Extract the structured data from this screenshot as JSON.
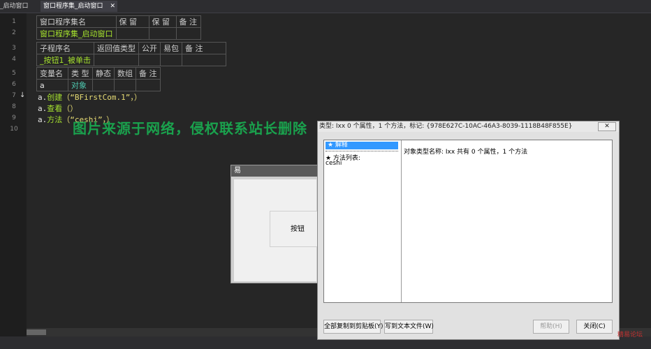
{
  "tabs": [
    {
      "label": "_启动窗口"
    },
    {
      "label": "窗口程序集_启动窗口",
      "close": "✕"
    }
  ],
  "line_numbers": [
    "1",
    "2",
    "3",
    "4",
    "5",
    "6",
    "7",
    "8",
    "9",
    "10"
  ],
  "assembly_table": {
    "headers": [
      "窗口程序集名",
      "保 留",
      "保 留",
      "备 注"
    ],
    "row": [
      "窗口程序集_启动窗口",
      "",
      "",
      ""
    ]
  },
  "sub_table": {
    "headers": [
      "子程序名",
      "返回值类型",
      "公开",
      "易包",
      "备 注"
    ],
    "row": [
      "_按钮1_被单击",
      "",
      "",
      "",
      ""
    ]
  },
  "var_table": {
    "headers": [
      "变量名",
      "类 型",
      "静态",
      "数组",
      "备 注"
    ],
    "row": [
      "a",
      "对象",
      "",
      "",
      ""
    ]
  },
  "code_lines": [
    {
      "obj": "a.",
      "method": "创建",
      "args": "（“BFirstCom.1”，）"
    },
    {
      "obj": "a.",
      "method": "查看",
      "args": "（）"
    },
    {
      "obj": "a.",
      "method": "方法",
      "args": "（“ceshi”，）"
    }
  ],
  "watermark": "图片来源于网络，侵权联系站长删除",
  "window1": {
    "title": "易",
    "button": "按钮"
  },
  "dialog": {
    "title": "类型: Ixx  0 个属性，1 个方法，标记: {978E627C-10AC-46A3-8039-1118B48F855E}",
    "close": "✕",
    "left_selected": "★ 解释",
    "method_header": "★ 方法列表:",
    "method_item": "ceshi",
    "right_text": "对象类型名称: Ixx     共有 0 个属性，1 个方法",
    "buttons": {
      "copy": "全部复制到剪贴板(Y)",
      "write": "写到文本文件(W)",
      "help": "帮助(H)",
      "close": "关闭(C)"
    }
  },
  "corner_watermark": "精易论坛"
}
